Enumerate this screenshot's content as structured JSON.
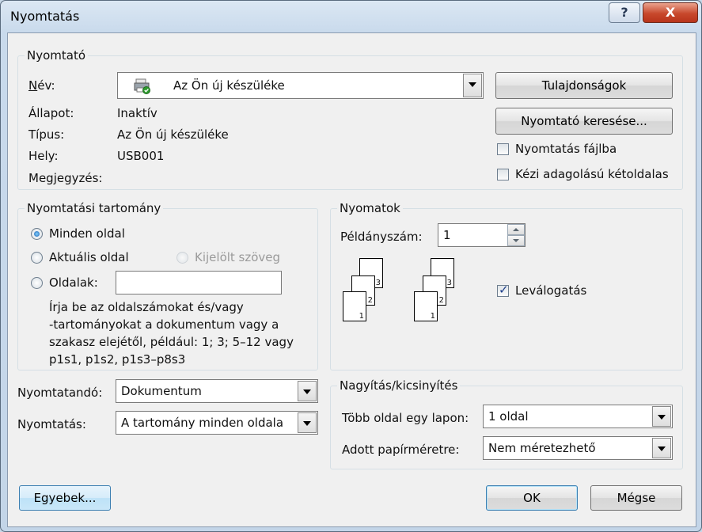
{
  "window": {
    "title": "Nyomtatás",
    "help": "?",
    "close": "X"
  },
  "printer": {
    "legend": "Nyomtató",
    "name_label": "Név:",
    "name_value": "Az Ön új készüléke",
    "status_label": "Állapot:",
    "status_value": "Inaktív",
    "type_label": "Típus:",
    "type_value": "Az Ön új készüléke",
    "location_label": "Hely:",
    "location_value": "USB001",
    "comment_label": "Megjegyzés:",
    "comment_value": "",
    "properties_button": "Tulajdonságok",
    "find_button": "Nyomtató keresése...",
    "print_to_file": {
      "label": "Nyomtatás fájlba",
      "checked": false
    },
    "manual_duplex": {
      "label": "Kézi adagolású kétoldalas",
      "checked": false
    }
  },
  "range": {
    "legend": "Nyomtatási tartomány",
    "all_pages": {
      "label": "Minden oldal",
      "selected": true
    },
    "current_page": {
      "label": "Aktuális oldal",
      "selected": false
    },
    "selection": {
      "label": "Kijelölt szöveg",
      "enabled": false
    },
    "pages": {
      "label": "Oldalak:",
      "value": ""
    },
    "hint_lines": [
      "Írja be az oldalszámokat és/vagy",
      "-tartományokat a dokumentum vagy a",
      "szakasz elejétől, például: 1; 3; 5–12 vagy",
      "p1s1, p1s2, p1s3–p8s3"
    ]
  },
  "copies": {
    "legend": "Nyomatok",
    "count_label": "Példányszám:",
    "count_value": "1",
    "collate": {
      "label": "Leválogatás",
      "checked": true
    },
    "page_numbers": [
      "1",
      "2",
      "3"
    ]
  },
  "print_what": {
    "label": "Nyomtatandó:",
    "value": "Dokumentum"
  },
  "print_mode": {
    "label": "Nyomtatás:",
    "value": "A tartomány minden oldala"
  },
  "zoom": {
    "legend": "Nagyítás/kicsinyítés",
    "pages_per_sheet_label": "Több oldal egy lapon:",
    "pages_per_sheet_value": "1 oldal",
    "scale_label": "Adott papírméretre:",
    "scale_value": "Nem méretezhető"
  },
  "buttons": {
    "options": "Egyebek...",
    "ok": "OK",
    "cancel": "Mégse"
  }
}
